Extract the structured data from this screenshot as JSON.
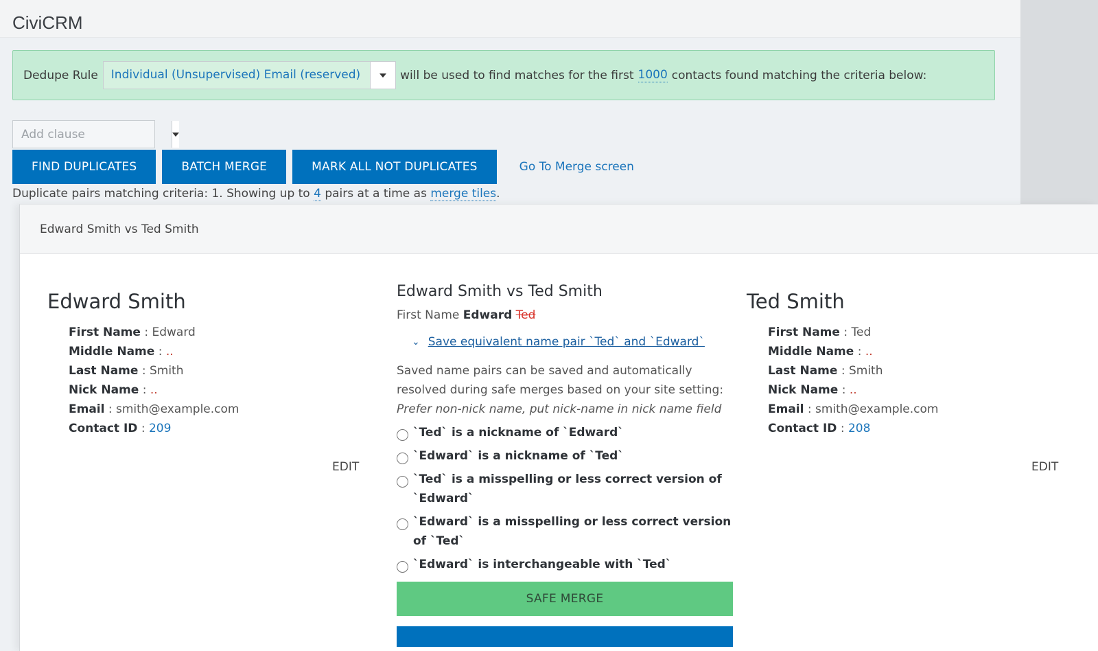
{
  "app": {
    "title": "CiviCRM"
  },
  "dedupe": {
    "label": "Dedupe Rule",
    "rule_value": "Individual (Unsupervised) Email (reserved)",
    "text_before_limit": "will be used to find matches for the first",
    "limit": "1000",
    "text_after_limit": "contacts found matching the criteria below:"
  },
  "clause": {
    "placeholder": "Add clause"
  },
  "buttons": {
    "find": "FIND DUPLICATES",
    "batch": "BATCH MERGE",
    "mark_all": "MARK ALL NOT DUPLICATES",
    "go_merge": "Go To Merge screen"
  },
  "criteria": {
    "prefix": "Duplicate pairs matching criteria: 1. Showing up to",
    "count": "4",
    "middle": "pairs at a time as",
    "link": "merge tiles",
    "suffix": "."
  },
  "dialog": {
    "header": "Edward Smith vs Ted Smith",
    "left": {
      "name": "Edward Smith",
      "fields": [
        {
          "label": "First Name",
          "value": "Edward"
        },
        {
          "label": "Middle Name",
          "value": ".."
        },
        {
          "label": "Last Name",
          "value": "Smith"
        },
        {
          "label": "Nick Name",
          "value": ".."
        },
        {
          "label": "Email",
          "value": "smith@example.com"
        },
        {
          "label": "Contact ID",
          "value": "209"
        }
      ],
      "edit": "EDIT"
    },
    "right": {
      "name": "Ted Smith",
      "fields": [
        {
          "label": "First Name",
          "value": "Ted"
        },
        {
          "label": "Middle Name",
          "value": ".."
        },
        {
          "label": "Last Name",
          "value": "Smith"
        },
        {
          "label": "Nick Name",
          "value": ".."
        },
        {
          "label": "Email",
          "value": "smith@example.com"
        },
        {
          "label": "Contact ID",
          "value": "208"
        }
      ],
      "edit": "EDIT"
    },
    "middle": {
      "title": "Edward Smith vs Ted Smith",
      "first_name_label": "First Name",
      "first_name_keep": "Edward",
      "first_name_drop": "Ted",
      "save_pair": "Save equivalent name pair `Ted` and `Edward`",
      "desc": "Saved name pairs can be saved and automatically resolved during safe merges based on your site setting:",
      "desc_setting": "Prefer non-nick name, put nick-name in nick name field",
      "options": [
        "`Ted` is a nickname of `Edward`",
        "`Edward` is a nickname of `Ted`",
        "`Ted` is a misspelling or less correct version of `Edward`",
        "`Edward` is a misspelling or less correct version of `Ted`",
        "`Edward` is interchangeable with `Ted`"
      ],
      "safe_merge": "SAFE MERGE"
    }
  },
  "colors": {
    "primary": "#0071bd",
    "success": "#5fc982",
    "link": "#1b75bb",
    "alert_bg": "#c6ecd6"
  }
}
